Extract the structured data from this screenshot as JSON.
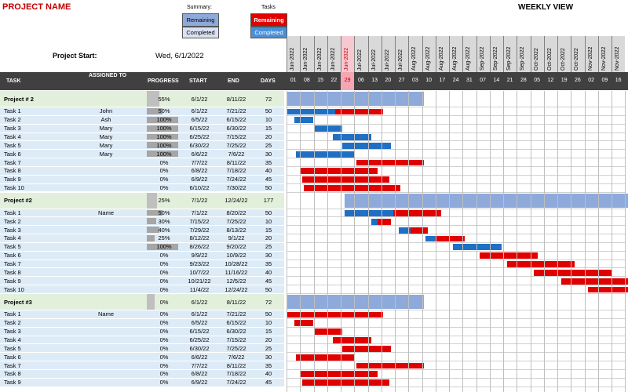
{
  "header": {
    "project_name": "PROJECT NAME",
    "weekly_view": "WEEKLY VIEW",
    "summary_label": "Summary:",
    "tasks_label": "Tasks",
    "summary_remaining": "Remaining",
    "summary_completed": "Completed",
    "tasks_remaining": "Remaining",
    "tasks_completed": "Completed",
    "project_start_label": "Project Start:",
    "project_start_value": "Wed, 6/1/2022"
  },
  "columns": {
    "task": "TASK",
    "assigned_to": "ASSIGNED TO",
    "progress": "PROGRESS",
    "start": "START",
    "end": "END",
    "days": "DAYS"
  },
  "colors": {
    "summary_remaining": "#8eaadb",
    "summary_completed": "#d9e1f2",
    "task_remaining": "#e00000",
    "task_completed": "#1f6fc5",
    "project_row_bg": "#e2efda",
    "task_row_bg": "#ddebf7",
    "today_highlight": "#f8c8d0"
  },
  "timeline": {
    "weeks": [
      {
        "month": "Jun-2022",
        "day": "01"
      },
      {
        "month": "Jun-2022",
        "day": "08"
      },
      {
        "month": "Jun-2022",
        "day": "15"
      },
      {
        "month": "Jun-2022",
        "day": "22"
      },
      {
        "month": "Jun-2022",
        "day": "29",
        "today": true
      },
      {
        "month": "Jul-2022",
        "day": "06"
      },
      {
        "month": "Jul-2022",
        "day": "13"
      },
      {
        "month": "Jul-2022",
        "day": "20"
      },
      {
        "month": "Jul-2022",
        "day": "27"
      },
      {
        "month": "Aug-2022",
        "day": "03"
      },
      {
        "month": "Aug-2022",
        "day": "10"
      },
      {
        "month": "Aug-2022",
        "day": "17"
      },
      {
        "month": "Aug-2022",
        "day": "24"
      },
      {
        "month": "Aug-2022",
        "day": "31"
      },
      {
        "month": "Sep-2022",
        "day": "07"
      },
      {
        "month": "Sep-2022",
        "day": "14"
      },
      {
        "month": "Sep-2022",
        "day": "21"
      },
      {
        "month": "Sep-2022",
        "day": "28"
      },
      {
        "month": "Oct-2022",
        "day": "05"
      },
      {
        "month": "Oct-2022",
        "day": "12"
      },
      {
        "month": "Oct-2022",
        "day": "19"
      },
      {
        "month": "Oct-2022",
        "day": "26"
      },
      {
        "month": "Nov-2022",
        "day": "02"
      },
      {
        "month": "Nov-2022",
        "day": "09"
      },
      {
        "month": "Nov-2022",
        "day": "16"
      }
    ]
  },
  "rows": [
    {
      "type": "project",
      "task": "Project # 2",
      "assigned": "",
      "progress": "55%",
      "pct": 55,
      "start": "6/1/22",
      "end": "8/11/22",
      "days": "72",
      "s": "2022-06-01",
      "e": "2022-08-11"
    },
    {
      "type": "task",
      "task": "Task 1",
      "assigned": "John",
      "progress": "50%",
      "pct": 50,
      "start": "6/1/22",
      "end": "7/21/22",
      "days": "50",
      "s": "2022-06-01",
      "e": "2022-07-21"
    },
    {
      "type": "task",
      "task": "Task 2",
      "assigned": "Ash",
      "progress": "100%",
      "pct": 100,
      "start": "6/5/22",
      "end": "6/15/22",
      "days": "10",
      "s": "2022-06-05",
      "e": "2022-06-15"
    },
    {
      "type": "task",
      "task": "Task 3",
      "assigned": "Mary",
      "progress": "100%",
      "pct": 100,
      "start": "6/15/22",
      "end": "6/30/22",
      "days": "15",
      "s": "2022-06-15",
      "e": "2022-06-30"
    },
    {
      "type": "task",
      "task": "Task 4",
      "assigned": "Mary",
      "progress": "100%",
      "pct": 100,
      "start": "6/25/22",
      "end": "7/15/22",
      "days": "20",
      "s": "2022-06-25",
      "e": "2022-07-15"
    },
    {
      "type": "task",
      "task": "Task 5",
      "assigned": "Mary",
      "progress": "100%",
      "pct": 100,
      "start": "6/30/22",
      "end": "7/25/22",
      "days": "25",
      "s": "2022-06-30",
      "e": "2022-07-25"
    },
    {
      "type": "task",
      "task": "Task 6",
      "assigned": "Mary",
      "progress": "100%",
      "pct": 100,
      "start": "6/6/22",
      "end": "7/6/22",
      "days": "30",
      "s": "2022-06-06",
      "e": "2022-07-06"
    },
    {
      "type": "task",
      "task": "Task 7",
      "assigned": "",
      "progress": "0%",
      "pct": 0,
      "start": "7/7/22",
      "end": "8/11/22",
      "days": "35",
      "s": "2022-07-07",
      "e": "2022-08-11"
    },
    {
      "type": "task",
      "task": "Task 8",
      "assigned": "",
      "progress": "0%",
      "pct": 0,
      "start": "6/8/22",
      "end": "7/18/22",
      "days": "40",
      "s": "2022-06-08",
      "e": "2022-07-18"
    },
    {
      "type": "task",
      "task": "Task 9",
      "assigned": "",
      "progress": "0%",
      "pct": 0,
      "start": "6/9/22",
      "end": "7/24/22",
      "days": "45",
      "s": "2022-06-09",
      "e": "2022-07-24"
    },
    {
      "type": "task",
      "task": "Task 10",
      "assigned": "",
      "progress": "0%",
      "pct": 0,
      "start": "6/10/22",
      "end": "7/30/22",
      "days": "50",
      "s": "2022-06-10",
      "e": "2022-07-30"
    },
    {
      "type": "project",
      "task": "Project #2",
      "assigned": "",
      "progress": "25%",
      "pct": 25,
      "start": "7/1/22",
      "end": "12/24/22",
      "days": "177",
      "s": "2022-07-01",
      "e": "2022-12-24"
    },
    {
      "type": "task",
      "task": "Task 1",
      "assigned": "Name",
      "progress": "50%",
      "pct": 50,
      "start": "7/1/22",
      "end": "8/20/22",
      "days": "50",
      "s": "2022-07-01",
      "e": "2022-08-20"
    },
    {
      "type": "task",
      "task": "Task 2",
      "assigned": "",
      "progress": "30%",
      "pct": 30,
      "start": "7/15/22",
      "end": "7/25/22",
      "days": "10",
      "s": "2022-07-15",
      "e": "2022-07-25"
    },
    {
      "type": "task",
      "task": "Task 3",
      "assigned": "",
      "progress": "40%",
      "pct": 40,
      "start": "7/29/22",
      "end": "8/13/22",
      "days": "15",
      "s": "2022-07-29",
      "e": "2022-08-13"
    },
    {
      "type": "task",
      "task": "Task 4",
      "assigned": "",
      "progress": "25%",
      "pct": 25,
      "start": "8/12/22",
      "end": "9/1/22",
      "days": "20",
      "s": "2022-08-12",
      "e": "2022-09-01"
    },
    {
      "type": "task",
      "task": "Task 5",
      "assigned": "",
      "progress": "100%",
      "pct": 100,
      "start": "8/26/22",
      "end": "9/20/22",
      "days": "25",
      "s": "2022-08-26",
      "e": "2022-09-20"
    },
    {
      "type": "task",
      "task": "Task 6",
      "assigned": "",
      "progress": "0%",
      "pct": 0,
      "start": "9/9/22",
      "end": "10/9/22",
      "days": "30",
      "s": "2022-09-09",
      "e": "2022-10-09"
    },
    {
      "type": "task",
      "task": "Task 7",
      "assigned": "",
      "progress": "0%",
      "pct": 0,
      "start": "9/23/22",
      "end": "10/28/22",
      "days": "35",
      "s": "2022-09-23",
      "e": "2022-10-28"
    },
    {
      "type": "task",
      "task": "Task 8",
      "assigned": "",
      "progress": "0%",
      "pct": 0,
      "start": "10/7/22",
      "end": "11/16/22",
      "days": "40",
      "s": "2022-10-07",
      "e": "2022-11-16"
    },
    {
      "type": "task",
      "task": "Task 9",
      "assigned": "",
      "progress": "0%",
      "pct": 0,
      "start": "10/21/22",
      "end": "12/5/22",
      "days": "45",
      "s": "2022-10-21",
      "e": "2022-12-05"
    },
    {
      "type": "task",
      "task": "Task 10",
      "assigned": "",
      "progress": "0%",
      "pct": 0,
      "start": "11/4/22",
      "end": "12/24/22",
      "days": "50",
      "s": "2022-11-04",
      "e": "2022-12-24"
    },
    {
      "type": "project",
      "task": "Project #3",
      "assigned": "",
      "progress": "0%",
      "pct": 0,
      "start": "6/1/22",
      "end": "8/11/22",
      "days": "72",
      "s": "2022-06-01",
      "e": "2022-08-11"
    },
    {
      "type": "task",
      "task": "Task 1",
      "assigned": "Name",
      "progress": "0%",
      "pct": 0,
      "start": "6/1/22",
      "end": "7/21/22",
      "days": "50",
      "s": "2022-06-01",
      "e": "2022-07-21"
    },
    {
      "type": "task",
      "task": "Task 2",
      "assigned": "",
      "progress": "0%",
      "pct": 0,
      "start": "6/5/22",
      "end": "6/15/22",
      "days": "10",
      "s": "2022-06-05",
      "e": "2022-06-15"
    },
    {
      "type": "task",
      "task": "Task 3",
      "assigned": "",
      "progress": "0%",
      "pct": 0,
      "start": "6/15/22",
      "end": "6/30/22",
      "days": "15",
      "s": "2022-06-15",
      "e": "2022-06-30"
    },
    {
      "type": "task",
      "task": "Task 4",
      "assigned": "",
      "progress": "0%",
      "pct": 0,
      "start": "6/25/22",
      "end": "7/15/22",
      "days": "20",
      "s": "2022-06-25",
      "e": "2022-07-15"
    },
    {
      "type": "task",
      "task": "Task 5",
      "assigned": "",
      "progress": "0%",
      "pct": 0,
      "start": "6/30/22",
      "end": "7/25/22",
      "days": "25",
      "s": "2022-06-30",
      "e": "2022-07-25"
    },
    {
      "type": "task",
      "task": "Task 6",
      "assigned": "",
      "progress": "0%",
      "pct": 0,
      "start": "6/6/22",
      "end": "7/6/22",
      "days": "30",
      "s": "2022-06-06",
      "e": "2022-07-06"
    },
    {
      "type": "task",
      "task": "Task 7",
      "assigned": "",
      "progress": "0%",
      "pct": 0,
      "start": "7/7/22",
      "end": "8/11/22",
      "days": "35",
      "s": "2022-07-07",
      "e": "2022-08-11"
    },
    {
      "type": "task",
      "task": "Task 8",
      "assigned": "",
      "progress": "0%",
      "pct": 0,
      "start": "6/8/22",
      "end": "7/18/22",
      "days": "40",
      "s": "2022-06-08",
      "e": "2022-07-18"
    },
    {
      "type": "task",
      "task": "Task 9",
      "assigned": "",
      "progress": "0%",
      "pct": 0,
      "start": "6/9/22",
      "end": "7/24/22",
      "days": "45",
      "s": "2022-06-09",
      "e": "2022-07-24"
    }
  ]
}
